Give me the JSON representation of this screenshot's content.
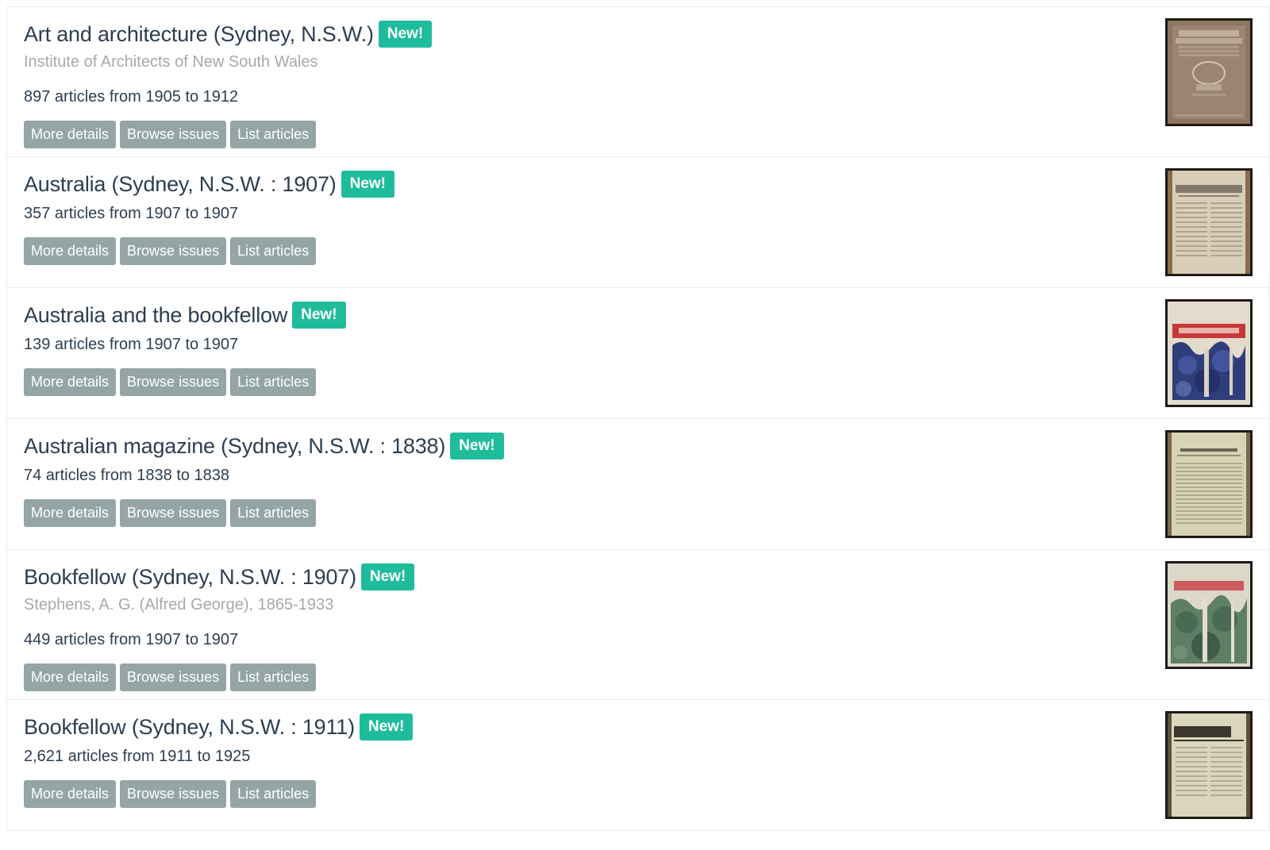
{
  "buttons": {
    "more_details": "More details",
    "browse_issues": "Browse issues",
    "list_articles": "List articles"
  },
  "badge_label": "New!",
  "colors": {
    "badge": "#1fbc9c",
    "button": "#95a5a6",
    "title": "#2c3e50",
    "subtitle": "#a8a8a8"
  },
  "items": [
    {
      "title": "Art and architecture (Sydney, N.S.W.)",
      "subtitle": "Institute of Architects of New South Wales",
      "summary": "897 articles from 1905 to 1912",
      "thumbnail": "cover-art-and-architecture"
    },
    {
      "title": "Australia (Sydney, N.S.W. : 1907)",
      "subtitle": "",
      "summary": "357 articles from 1907 to 1907",
      "thumbnail": "cover-australia-1907"
    },
    {
      "title": "Australia and the bookfellow",
      "subtitle": "",
      "summary": "139 articles from 1907 to 1907",
      "thumbnail": "cover-australia-bookfellow"
    },
    {
      "title": "Australian magazine (Sydney, N.S.W. : 1838)",
      "subtitle": "",
      "summary": "74 articles from 1838 to 1838",
      "thumbnail": "cover-australian-magazine"
    },
    {
      "title": "Bookfellow (Sydney, N.S.W. : 1907)",
      "subtitle": "Stephens, A. G. (Alfred George), 1865-1933",
      "summary": "449 articles from 1907 to 1907",
      "thumbnail": "cover-bookfellow-1907"
    },
    {
      "title": "Bookfellow (Sydney, N.S.W. : 1911)",
      "subtitle": "",
      "summary": "2,621 articles from 1911 to 1925",
      "thumbnail": "cover-bookfellow-1911"
    }
  ]
}
